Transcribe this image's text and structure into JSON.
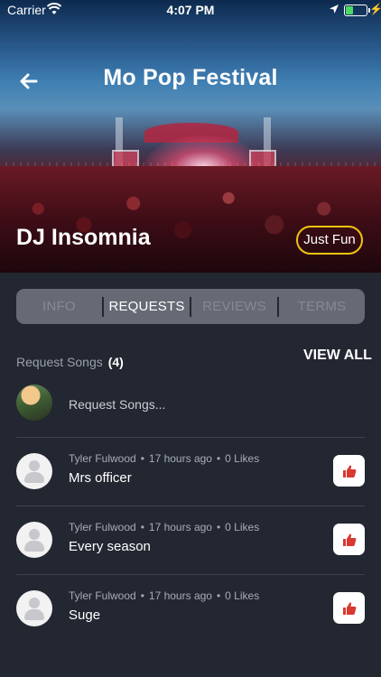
{
  "status": {
    "carrier": "Carrier",
    "time": "4:07 PM"
  },
  "header": {
    "title": "Mo Pop Festival"
  },
  "artist": {
    "name": "DJ Insomnia",
    "tag": "Just Fun"
  },
  "tabs": [
    {
      "label": "INFO"
    },
    {
      "label": "REQUESTS"
    },
    {
      "label": "REVIEWS"
    },
    {
      "label": "TERMS"
    }
  ],
  "requests": {
    "title": "Request Songs",
    "count": "(4)",
    "view_all": "VIEW ALL",
    "input_placeholder": "Request Songs...",
    "items": [
      {
        "user": "Tyler Fulwood",
        "time": "17 hours ago",
        "likes": "0 Likes",
        "song": "Mrs officer"
      },
      {
        "user": "Tyler Fulwood",
        "time": "17 hours ago",
        "likes": "0 Likes",
        "song": "Every season"
      },
      {
        "user": "Tyler Fulwood",
        "time": "17 hours ago",
        "likes": "0 Likes",
        "song": "Suge"
      }
    ]
  },
  "colors": {
    "background": "#232731",
    "accent": "#f1c40f",
    "like": "#d9382f"
  },
  "icons": [
    "wifi-icon",
    "location-icon",
    "battery-icon",
    "back-arrow-icon",
    "thumbs-up-icon",
    "user-avatar-icon"
  ]
}
